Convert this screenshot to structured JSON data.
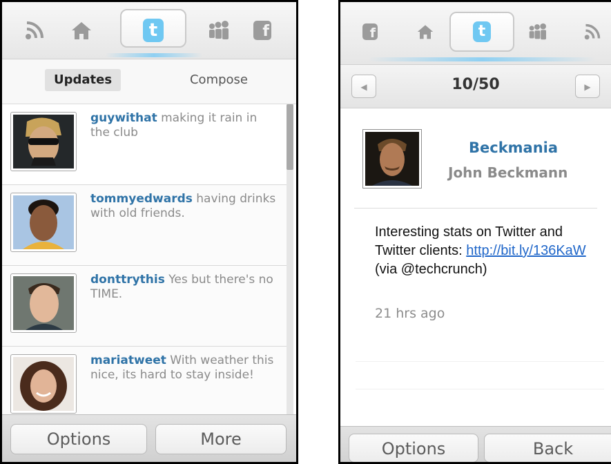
{
  "left_screen": {
    "nav_icons": [
      "rss-icon",
      "home-icon",
      "twitter-icon",
      "myspace-icon",
      "facebook-icon"
    ],
    "active_icon": "twitter-icon",
    "tabs": [
      {
        "label": "Updates",
        "selected": true
      },
      {
        "label": "Compose",
        "selected": false
      }
    ],
    "feed": [
      {
        "user": "guywithat",
        "text": "making it rain in the club"
      },
      {
        "user": "tommyedwards",
        "text": "having drinks with old friends."
      },
      {
        "user": "donttrythis",
        "text": "Yes but there's no TIME."
      },
      {
        "user": "mariatweet",
        "text": "With weather this nice, its hard to stay inside!"
      }
    ],
    "softkeys": {
      "left": "Options",
      "right": "More"
    }
  },
  "right_screen": {
    "nav_icons": [
      "facebook-icon",
      "home-icon",
      "twitter-icon",
      "myspace-icon",
      "rss-icon"
    ],
    "active_icon": "twitter-icon",
    "counter": "10/50",
    "detail": {
      "username": "Beckmania",
      "full_name": "John Beckmann",
      "text_before": "Interesting stats on Twitter and Twitter clients: ",
      "link": "http://bit.ly/136KaW",
      "text_after": " (via @techcrunch)",
      "time": "21 hrs ago"
    },
    "softkeys": {
      "left": "Options",
      "right": "Back"
    }
  },
  "colors": {
    "username_blue": "#2f73a7",
    "link_blue": "#1f66c9",
    "twitter_blue": "#6fc8f2",
    "muted_text": "#8a8a8a"
  }
}
